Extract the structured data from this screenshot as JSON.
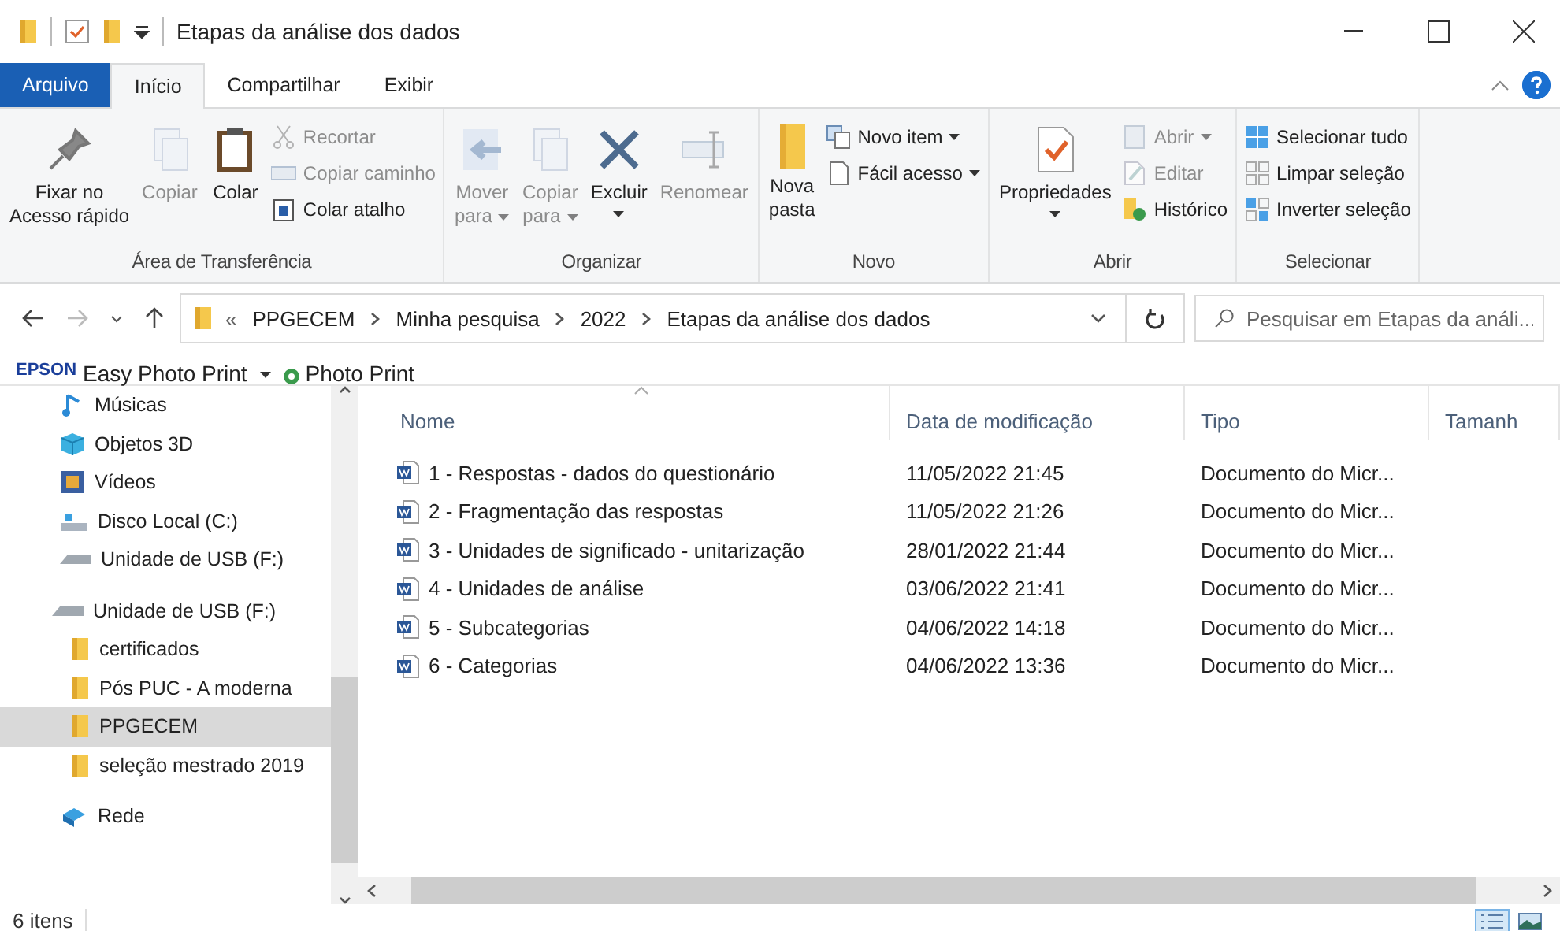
{
  "window": {
    "title": "Etapas da análise dos dados"
  },
  "ribbon_tabs": [
    {
      "label": "Arquivo",
      "kind": "file",
      "selected": false
    },
    {
      "label": "Início",
      "kind": "tab",
      "selected": true
    },
    {
      "label": "Compartilhar",
      "kind": "tab",
      "selected": false
    },
    {
      "label": "Exibir",
      "kind": "tab",
      "selected": false
    }
  ],
  "ribbon_groups": [
    {
      "label": "Área de Transferência",
      "large": [
        {
          "label": "Fixar no\nAcesso rápido",
          "kind": "pin",
          "disabled": false,
          "dropdown": false
        },
        {
          "label": "Copiar",
          "kind": "copy",
          "disabled": true,
          "dropdown": false
        },
        {
          "label": "Colar",
          "kind": "clipboard",
          "disabled": false,
          "dropdown": false
        }
      ],
      "small": [
        {
          "label": "Recortar",
          "kind": "scissors",
          "disabled": true,
          "dropdown": false
        },
        {
          "label": "Copiar caminho",
          "kind": "path",
          "disabled": true,
          "dropdown": false
        },
        {
          "label": "Colar atalho",
          "kind": "shortcut",
          "disabled": false,
          "dropdown": false
        }
      ]
    },
    {
      "label": "Organizar",
      "large": [
        {
          "label": "Mover\npara",
          "kind": "move",
          "disabled": true,
          "dropdown": true
        },
        {
          "label": "Copiar\npara",
          "kind": "copy",
          "disabled": true,
          "dropdown": true
        },
        {
          "label": "Excluir",
          "kind": "delete",
          "disabled": false,
          "dropdown": true
        },
        {
          "label": "Renomear",
          "kind": "rename",
          "disabled": true,
          "dropdown": false
        }
      ]
    },
    {
      "label": "Novo",
      "large": [
        {
          "label": "Nova\npasta",
          "kind": "folder",
          "disabled": false,
          "dropdown": false
        }
      ],
      "small": [
        {
          "label": "Novo item",
          "kind": "newitem",
          "disabled": false,
          "dropdown": true
        },
        {
          "label": "Fácil acesso",
          "kind": "page",
          "disabled": false,
          "dropdown": true
        }
      ]
    },
    {
      "label": "Abrir",
      "large": [
        {
          "label": "Propriedades",
          "kind": "properties",
          "disabled": false,
          "dropdown": true
        }
      ],
      "small": [
        {
          "label": "Abrir",
          "kind": "open",
          "disabled": true,
          "dropdown": true
        },
        {
          "label": "Editar",
          "kind": "edit",
          "disabled": true,
          "dropdown": false
        },
        {
          "label": "Histórico",
          "kind": "history",
          "disabled": false,
          "dropdown": false
        }
      ]
    },
    {
      "label": "Selecionar",
      "small": [
        {
          "label": "Selecionar tudo",
          "kind": "selectall",
          "disabled": false,
          "dropdown": false
        },
        {
          "label": "Limpar seleção",
          "kind": "selectnone",
          "disabled": false,
          "dropdown": false
        },
        {
          "label": "Inverter seleção",
          "kind": "invert",
          "disabled": false,
          "dropdown": false
        }
      ]
    }
  ],
  "address": {
    "overflow": "«",
    "crumbs": [
      "PPGECEM",
      "Minha pesquisa",
      "2022",
      "Etapas da análise dos dados"
    ]
  },
  "search": {
    "placeholder": "Pesquisar em Etapas da análi..."
  },
  "epson_toolbar": {
    "logo": "EPSON",
    "items": [
      "Easy Photo Print",
      "Photo Print"
    ]
  },
  "sidebar": {
    "items": [
      {
        "label": "Músicas",
        "kind": "music",
        "selected": false
      },
      {
        "label": "Objetos 3D",
        "kind": "cube",
        "selected": false
      },
      {
        "label": "Vídeos",
        "kind": "video",
        "selected": false
      },
      {
        "label": "Disco Local (C:)",
        "kind": "disk",
        "selected": false
      },
      {
        "label": "Unidade de USB (F:)",
        "kind": "usb",
        "selected": false
      },
      {
        "label": "Unidade de USB (F:)",
        "kind": "usb",
        "selected": false,
        "children": [
          {
            "label": "certificados",
            "kind": "folder",
            "selected": false
          },
          {
            "label": "Pós PUC -  A moderna",
            "kind": "folder",
            "selected": false
          },
          {
            "label": "PPGECEM",
            "kind": "folder",
            "selected": true
          },
          {
            "label": "seleção mestrado 2019",
            "kind": "folder",
            "selected": false
          }
        ]
      },
      {
        "label": "Rede",
        "kind": "network",
        "selected": false
      }
    ]
  },
  "table": {
    "columns": [
      "Nome",
      "Data de modificação",
      "Tipo",
      "Tamanh"
    ],
    "rows": [
      {
        "name": "1 - Respostas - dados do questionário",
        "modified": "11/05/2022 21:45",
        "type": "Documento do Micr..."
      },
      {
        "name": "2 - Fragmentação das respostas",
        "modified": "11/05/2022 21:26",
        "type": "Documento do Micr..."
      },
      {
        "name": "3 - Unidades de significado - unitarização",
        "modified": "28/01/2022 21:44",
        "type": "Documento do Micr..."
      },
      {
        "name": "4 - Unidades de análise",
        "modified": "03/06/2022 21:41",
        "type": "Documento do Micr..."
      },
      {
        "name": "5 - Subcategorias",
        "modified": "04/06/2022 14:18",
        "type": "Documento do Micr..."
      },
      {
        "name": "6 - Categorias",
        "modified": "04/06/2022 13:36",
        "type": "Documento do Micr..."
      }
    ]
  },
  "status_bar": {
    "count": "6 itens",
    "views": [
      {
        "kind": "details",
        "selected": true
      },
      {
        "kind": "large",
        "selected": false
      }
    ]
  }
}
